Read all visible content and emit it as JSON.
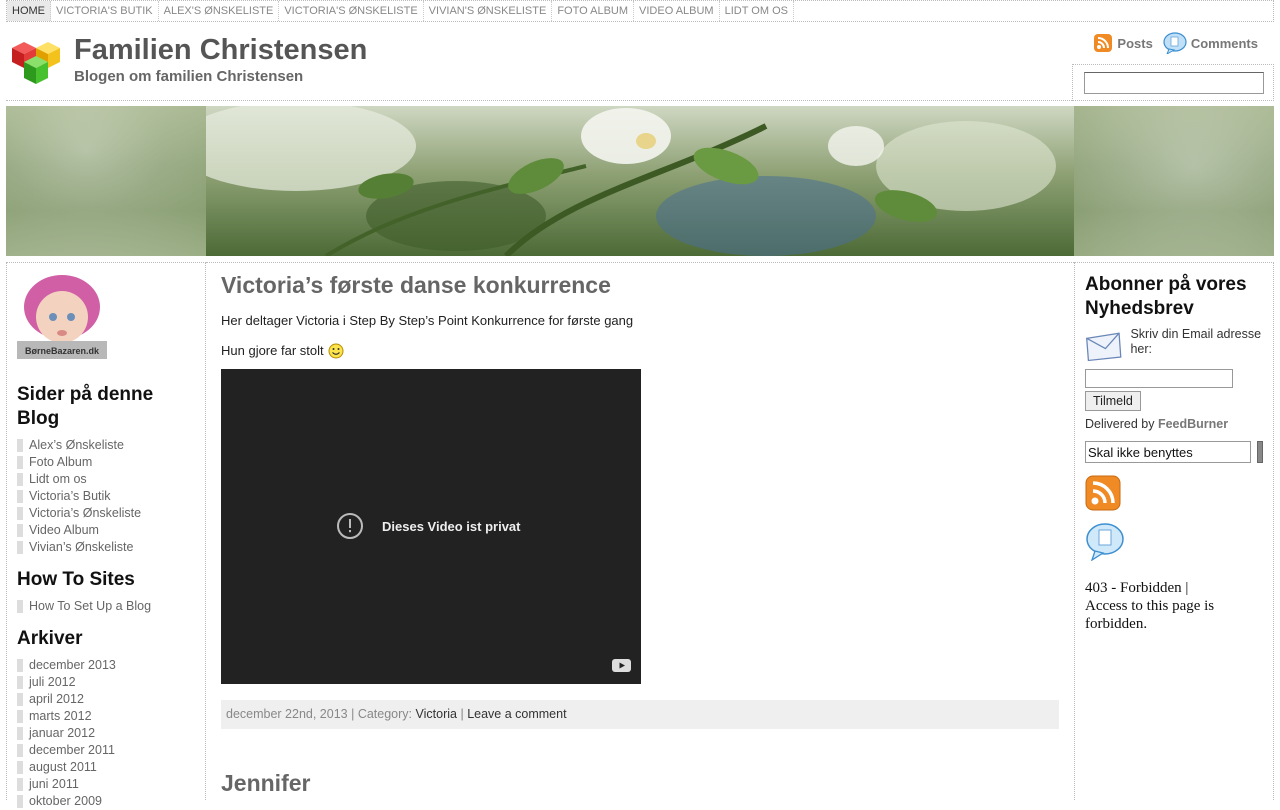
{
  "nav": {
    "items": [
      {
        "label": "HOME"
      },
      {
        "label": "VICTORIA'S BUTIK"
      },
      {
        "label": "ALEX'S ØNSKELISTE"
      },
      {
        "label": "VICTORIA'S ØNSKELISTE"
      },
      {
        "label": "VIVIAN'S ØNSKELISTE"
      },
      {
        "label": "FOTO ALBUM"
      },
      {
        "label": "VIDEO ALBUM"
      },
      {
        "label": "LIDT OM OS"
      }
    ]
  },
  "header": {
    "title": "Familien Christensen",
    "tagline": "Blogen om familien Christensen",
    "posts_label": "Posts",
    "comments_label": "Comments"
  },
  "sidebar_left": {
    "avatar_caption": "BørneBazaren.dk",
    "pages": {
      "title": "Sider på denne Blog",
      "items": [
        {
          "label": "Alex’s Ønskeliste"
        },
        {
          "label": "Foto Album"
        },
        {
          "label": "Lidt om os"
        },
        {
          "label": "Victoria’s Butik"
        },
        {
          "label": "Victoria’s Ønskeliste"
        },
        {
          "label": "Video Album"
        },
        {
          "label": "Vivian’s Ønskeliste"
        }
      ]
    },
    "howto": {
      "title": "How To Sites",
      "items": [
        {
          "label": "How To Set Up a Blog"
        }
      ]
    },
    "archive": {
      "title": "Arkiver",
      "items": [
        {
          "label": "december 2013"
        },
        {
          "label": "juli 2012"
        },
        {
          "label": "april 2012"
        },
        {
          "label": "marts 2012"
        },
        {
          "label": "januar 2012"
        },
        {
          "label": "december 2011"
        },
        {
          "label": "august 2011"
        },
        {
          "label": "juni 2011"
        },
        {
          "label": "oktober 2009"
        }
      ]
    }
  },
  "posts": [
    {
      "title": "Victoria’s første danse konkurrence",
      "text1": "Her deltager Victoria i Step By Step’s Point Konkurrence for første gang",
      "text2": "Hun gjore far stolt",
      "video_message": "Dieses Video ist privat",
      "meta_date": "december 22nd, 2013",
      "meta_category_label": "| Category:",
      "meta_category": "Victoria",
      "meta_sep": "|",
      "meta_comment": "Leave a comment"
    },
    {
      "title": "Jennifer"
    }
  ],
  "sidebar_right": {
    "newsletter_title": "Abonner på vores Nyhedsbrev",
    "email_prompt": "Skriv din Email adresse her:",
    "email_value": "",
    "subscribe_label": "Tilmeld",
    "delivered_by": "Delivered by",
    "feedburner": "FeedBurner",
    "skal_value": "Skal ikke benyttes",
    "forbidden_line1": "403 - Forbidden |",
    "forbidden_line2": "Access to this page is forbidden."
  },
  "colors": {
    "rss_orange": "#f08a24",
    "accent_grey": "#666666"
  }
}
